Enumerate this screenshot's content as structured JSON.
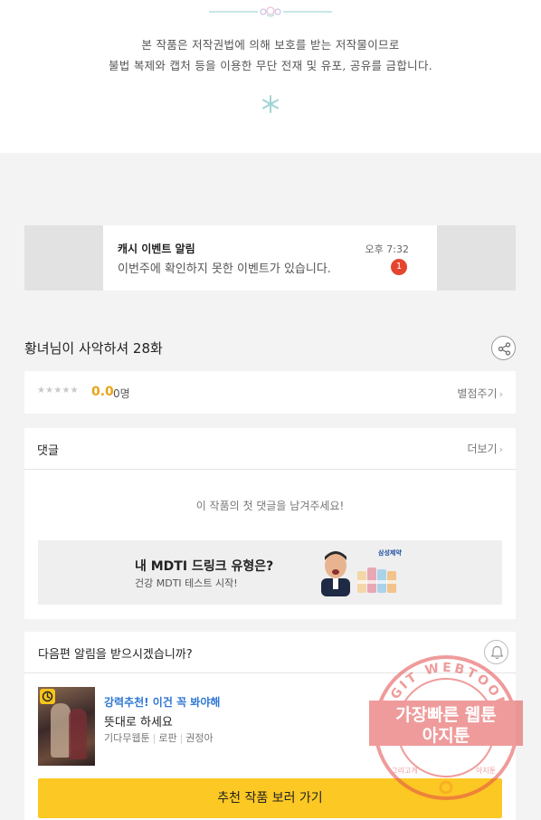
{
  "notice": {
    "line1": "본 작품은 저작권법에 의해 보호를 받는 저작물이므로",
    "line2": "불법 복제와 캡처 등을 이용한 무단 전재 및 유포, 공유를 금합니다."
  },
  "banner": {
    "title": "캐시 이벤트 알림",
    "message": "이번주에 확인하지 못한 이벤트가 있습니다.",
    "time": "오후 7:32",
    "badge_count": "1"
  },
  "episode": {
    "title": "황녀님이 사악하셔 28화"
  },
  "rating": {
    "stars": "★★★★★",
    "score": "0.0",
    "count": "0명",
    "rate_label": "별점주기",
    "star_color": "#c9c9c9",
    "score_color": "#e7a418"
  },
  "comments": {
    "title": "댓글",
    "more_label": "더보기",
    "empty_message": "이 작품의 첫 댓글을 남겨주세요!"
  },
  "ad": {
    "headline": "내 MDTI 드링크 유형은?",
    "subline": "건강 MDTI 테스트 시작!",
    "brand": "삼성제약"
  },
  "next": {
    "question": "다음편 알림을 받으시겠습니까?",
    "recommend_label": "강력추천! 이건 꼭 봐야해",
    "work_title": "뜻대로 하세요",
    "tags": [
      "기다무웹툰",
      "로판",
      "권정아"
    ],
    "button_label": "추천 작품 보러 가기",
    "button_color": "#fcc824",
    "recommend_color": "#2f77d4"
  },
  "stamp": {
    "ring_text": "AGIT WEBTOON",
    "line1": "가장빠른 웹툰",
    "line2": "아지툰",
    "bottom_left": "그리고게",
    "bottom_right": "아지툰"
  },
  "icons": {
    "share": "share-icon",
    "bell": "bell-icon",
    "ornament": "floral-ornament-icon",
    "snowflake": "snowflake-icon",
    "clock": "clock-icon",
    "chevron": "chevron-right-icon"
  }
}
